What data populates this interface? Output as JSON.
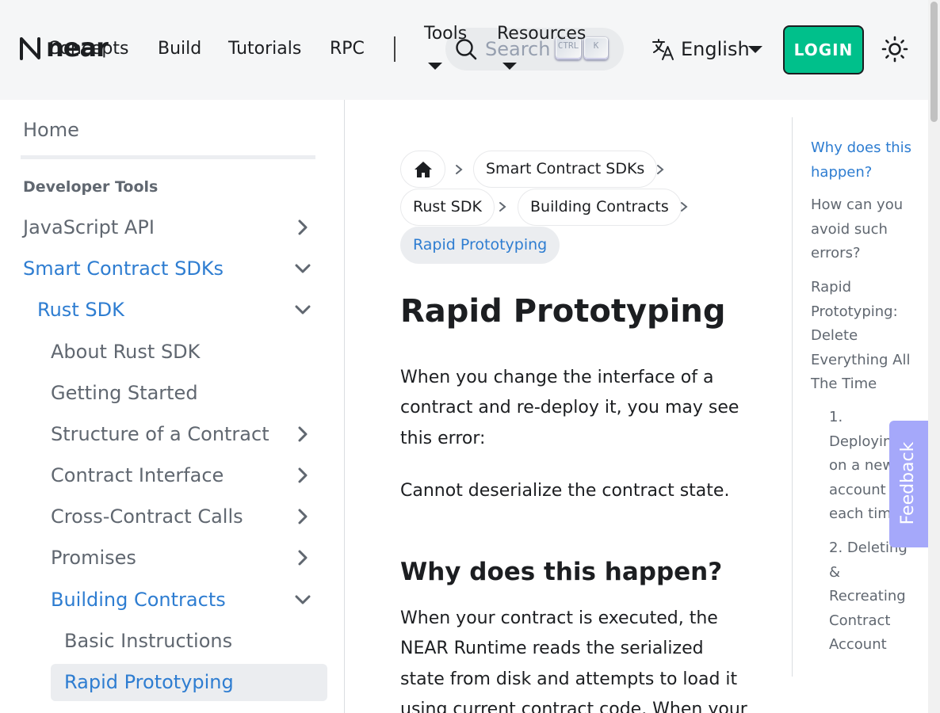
{
  "navbar": {
    "logo_text": "near",
    "links": [
      "Concepts",
      "Build",
      "Tutorials",
      "RPC"
    ],
    "dropdowns": [
      "Tools",
      "Resources"
    ],
    "search": {
      "placeholder": "Search",
      "key_ctrl": "CTRL",
      "key_k": "K"
    },
    "language": "English",
    "login_label": "LOGIN"
  },
  "sidebar": {
    "home": "Home",
    "category": "Developer Tools",
    "items": [
      {
        "label": "JavaScript API"
      },
      {
        "label": "Smart Contract SDKs"
      },
      {
        "label": "Rust SDK"
      },
      {
        "label": "About Rust SDK"
      },
      {
        "label": "Getting Started"
      },
      {
        "label": "Structure of a Contract"
      },
      {
        "label": "Contract Interface"
      },
      {
        "label": "Cross-Contract Calls"
      },
      {
        "label": "Promises"
      },
      {
        "label": "Building Contracts"
      },
      {
        "label": "Basic Instructions"
      },
      {
        "label": "Rapid Prototyping"
      }
    ]
  },
  "breadcrumbs": [
    "Smart Contract SDKs",
    "Rust SDK",
    "Building Contracts",
    "Rapid Prototyping"
  ],
  "article": {
    "title": "Rapid Prototyping",
    "intro": "When you change the interface of a contract and re-deploy it, you may see this error:",
    "error": "Cannot deserialize the contract state.",
    "h2": "Why does this happen?",
    "body": "When your contract is executed, the NEAR Runtime reads the serialized state from disk and attempts to load it using current contract code. When your"
  },
  "toc": [
    "Why does this happen?",
    "How can you avoid such errors?",
    "Rapid Prototyping: Delete Everything All The Time",
    "1. Deploying on a new account each time",
    "2. Deleting & Recreating Contract Account"
  ],
  "feedback_label": "Feedback",
  "colors": {
    "accent": "#2e7dd1",
    "login_bg": "#00c08b",
    "feedback_bg": "#a5a8fa"
  }
}
